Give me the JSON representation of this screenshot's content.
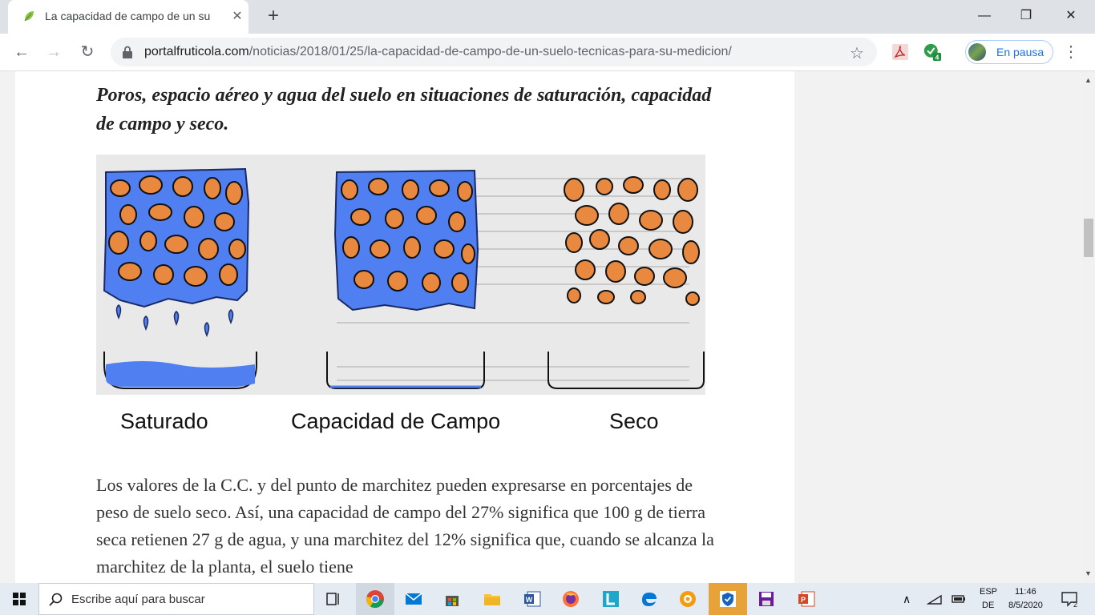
{
  "browser": {
    "tab": {
      "title": "La capacidad de campo de un su",
      "favicon": "leaf-icon"
    },
    "url": {
      "domain": "portalfruticola.com",
      "path": "/noticias/2018/01/25/la-capacidad-de-campo-de-un-suelo-tecnicas-para-su-medicion/"
    },
    "profile_label": "En pausa",
    "extension_badge": "4"
  },
  "article": {
    "caption": "Poros, espacio aéreo y agua del suelo en situaciones de saturación, capacidad de campo y seco.",
    "figure_labels": [
      "Saturado",
      "Capacidad de Campo",
      "Seco"
    ],
    "paragraph": "Los valores de la C.C. y del punto de marchitez pueden expresarse en porcentajes de peso de suelo seco. Así, una capacidad de campo del 27% significa que 100 g de tierra seca retienen 27 g de agua, y una marchitez del 12% significa que, cuando se alcanza la marchitez de la planta, el suelo tiene"
  },
  "taskbar": {
    "search_placeholder": "Escribe aquí para buscar",
    "language": "ESP",
    "language_sub": "DE",
    "time": "11:46",
    "date": "8/5/2020",
    "notifications": "2"
  },
  "colors": {
    "water": "#4f7ff0",
    "soil": "#e8893f",
    "accent": "#1a73e8"
  }
}
